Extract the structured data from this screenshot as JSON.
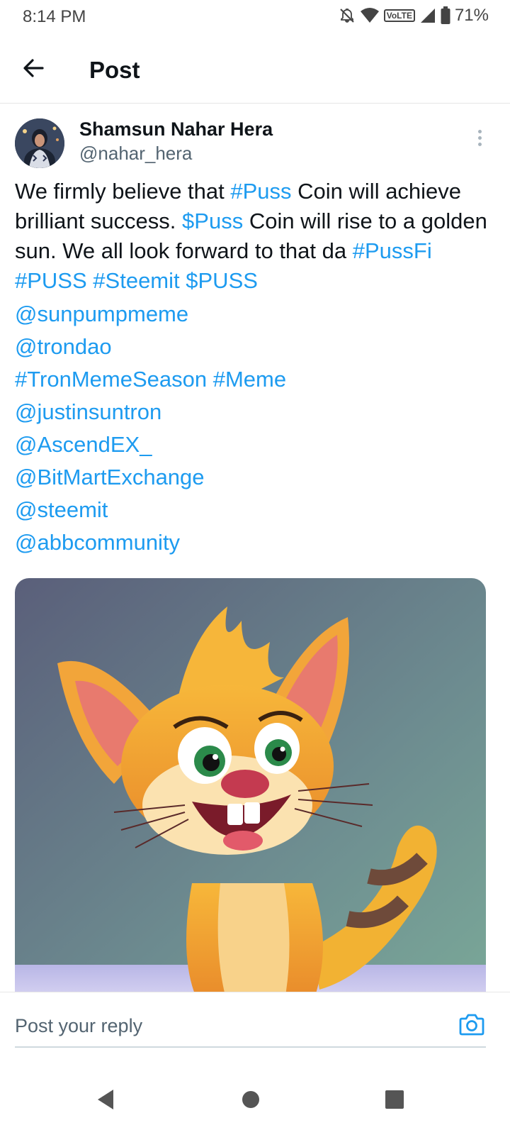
{
  "status_bar": {
    "time": "8:14 PM",
    "network_badge": "VoLTE",
    "battery": "71%",
    "icons": [
      "bell-off-icon",
      "wifi-icon",
      "signal-icon",
      "battery-icon"
    ]
  },
  "header": {
    "title": "Post",
    "back_icon": "arrow-left-icon"
  },
  "post": {
    "author_name": "Shamsun Nahar Hera",
    "author_handle": "@nahar_hera",
    "body": {
      "t1": "We firmly believe that ",
      "tag_puss": "#Puss",
      "t2": " Coin will achieve brilliant success. ",
      "cash_puss": "$Puss",
      "t3": " Coin will rise to a golden sun. We all look forward to that da ",
      "tag_pussfi": "#PussFi",
      "tag_puss_caps": "#PUSS",
      "tag_steemit": "#Steemit",
      "cash_puss_caps": "$PUSS",
      "mention_sunpumpmeme": "@sunpumpmeme",
      "mention_trondao": "@trondao",
      "tag_tronmemeseason": "#TronMemeSeason",
      "tag_meme": "#Meme",
      "mention_justinsuntron": "@justinsuntron",
      "mention_ascendex": "@AscendEX_",
      "mention_bitmart": "@BitMartExchange",
      "mention_steemit": "@steemit",
      "mention_abbcommunity": "@abbcommunity"
    },
    "media_description": "cartoon-cat-image"
  },
  "reply": {
    "placeholder": "Post your reply",
    "camera_icon": "camera-icon"
  },
  "navigation": {
    "back": "nav-back-icon",
    "home": "nav-home-icon",
    "recents": "nav-recents-icon"
  },
  "colors": {
    "link": "#1d9bf0",
    "text": "#0f1419",
    "secondary": "#536471"
  }
}
